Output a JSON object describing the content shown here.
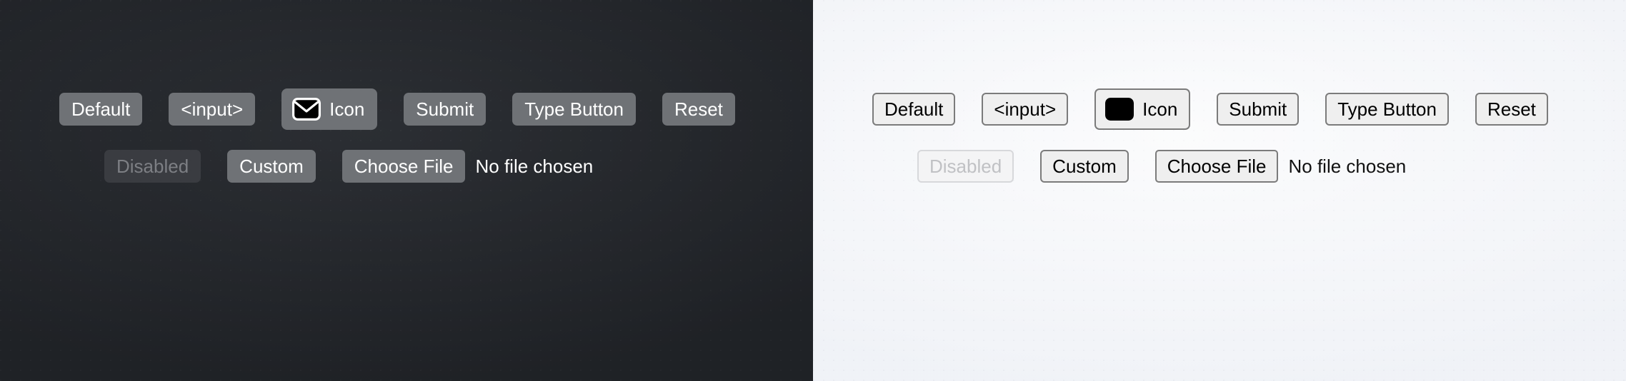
{
  "panels": [
    {
      "theme": "dark",
      "name": "dark-panel",
      "background_color": "#24272c",
      "button_color": "#6f7276",
      "text_color": "#ffffff",
      "disabled_fill": "#3a3c41",
      "disabled_text": "#7d7f84",
      "row_one": [
        {
          "label": "Default",
          "name": "default-button"
        },
        {
          "label": "<input>",
          "name": "input-button"
        },
        {
          "label": "Icon",
          "name": "icon-button",
          "icon": "envelope-icon"
        },
        {
          "label": "Submit",
          "name": "submit-button"
        },
        {
          "label": "Type Button",
          "name": "type-button"
        },
        {
          "label": "Reset",
          "name": "reset-button"
        }
      ],
      "row_two": [
        {
          "label": "Disabled",
          "name": "disabled-button",
          "disabled": true
        },
        {
          "label": "Custom",
          "name": "custom-button"
        },
        {
          "label": "Choose File",
          "name": "choose-file-button"
        }
      ],
      "file_status": "No file chosen"
    },
    {
      "theme": "light",
      "name": "light-panel",
      "background_color": "#f7f8fa",
      "button_color": "#efefef",
      "border_color": "#7b7b7b",
      "text_color": "#000000",
      "disabled_fill": "#f4f4f5",
      "disabled_text": "#c0c1c4",
      "row_one": [
        {
          "label": "Default",
          "name": "default-button"
        },
        {
          "label": "<input>",
          "name": "input-button"
        },
        {
          "label": "Icon",
          "name": "icon-button",
          "icon": "envelope-icon"
        },
        {
          "label": "Submit",
          "name": "submit-button"
        },
        {
          "label": "Type Button",
          "name": "type-button"
        },
        {
          "label": "Reset",
          "name": "reset-button"
        }
      ],
      "row_two": [
        {
          "label": "Disabled",
          "name": "disabled-button",
          "disabled": true
        },
        {
          "label": "Custom",
          "name": "custom-button"
        },
        {
          "label": "Choose File",
          "name": "choose-file-button"
        }
      ],
      "file_status": "No file chosen"
    }
  ]
}
